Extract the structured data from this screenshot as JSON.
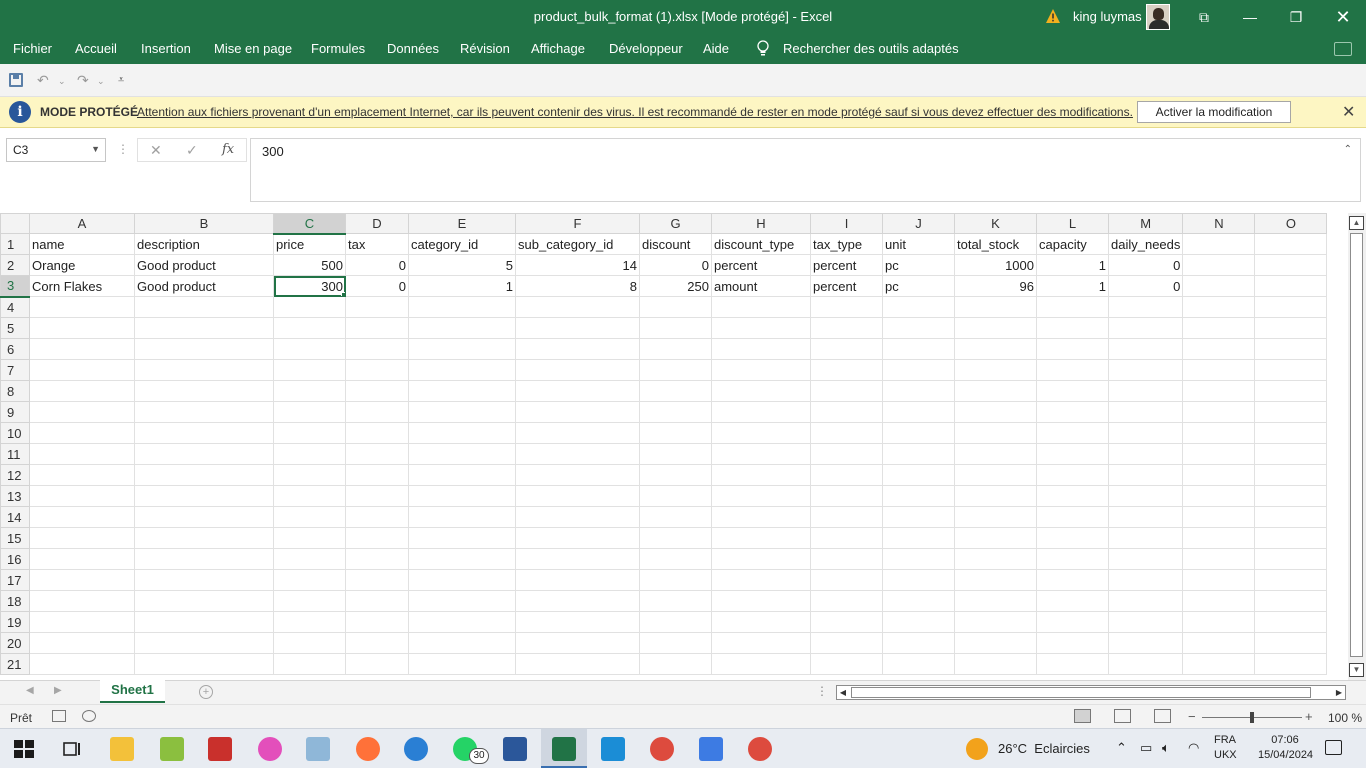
{
  "window": {
    "title": "product_bulk_format (1).xlsx  [Mode protégé]  -  Excel",
    "user": "king luymas",
    "controls": [
      "⧉",
      "—",
      "⧠",
      "✕"
    ]
  },
  "menu": {
    "items": [
      "Fichier",
      "Accueil",
      "Insertion",
      "Mise en page",
      "Formules",
      "Données",
      "Révision",
      "Affichage",
      "Développeur",
      "Aide"
    ],
    "search": "Rechercher des outils adaptés"
  },
  "protected_view": {
    "label": "MODE PROTÉGÉ",
    "message": "Attention aux fichiers provenant d'un emplacement Internet, car ils peuvent contenir des virus. Il est recommandé de rester en mode protégé sauf si vous devez effectuer des modifications.",
    "button": "Activer la modification"
  },
  "formula_bar": {
    "name_box": "C3",
    "value": "300",
    "fx": "fx"
  },
  "sheet": {
    "columns": [
      "A",
      "B",
      "C",
      "D",
      "E",
      "F",
      "G",
      "H",
      "I",
      "J",
      "K",
      "L",
      "M",
      "N",
      "O"
    ],
    "selected_column": "C",
    "selected_row": "3",
    "row_numbers": [
      "1",
      "2",
      "3",
      "4",
      "5",
      "6",
      "7",
      "8",
      "9",
      "10",
      "11",
      "12",
      "13",
      "14",
      "15",
      "16",
      "17",
      "18",
      "19",
      "20",
      "21"
    ],
    "rows": [
      [
        "name",
        "description",
        "price",
        "tax",
        "category_id",
        "sub_category_id",
        "discount",
        "discount_type",
        "tax_type",
        "unit",
        "total_stock",
        "capacity",
        "daily_needs",
        "",
        ""
      ],
      [
        "Orange",
        "Good product",
        "500",
        "0",
        "5",
        "14",
        "0",
        "percent",
        "percent",
        "pc",
        "1000",
        "1",
        "0",
        "",
        ""
      ],
      [
        "Corn Flakes",
        "Good product",
        "300",
        "0",
        "1",
        "8",
        "250",
        "amount",
        "percent",
        "pc",
        "96",
        "1",
        "0",
        "",
        ""
      ]
    ],
    "tab": "Sheet1"
  },
  "status": {
    "ready": "Prêt",
    "zoom": "100 %"
  },
  "taskbar": {
    "whatsapp_badge": "30",
    "temperature": "26°C",
    "weather": "Eclaircies",
    "lang_top": "FRA",
    "lang_bottom": "UKX",
    "time": "07:06",
    "date": "15/04/2024"
  },
  "colors": {
    "excel_green": "#217346",
    "protected_bar": "#fdf6c3"
  }
}
